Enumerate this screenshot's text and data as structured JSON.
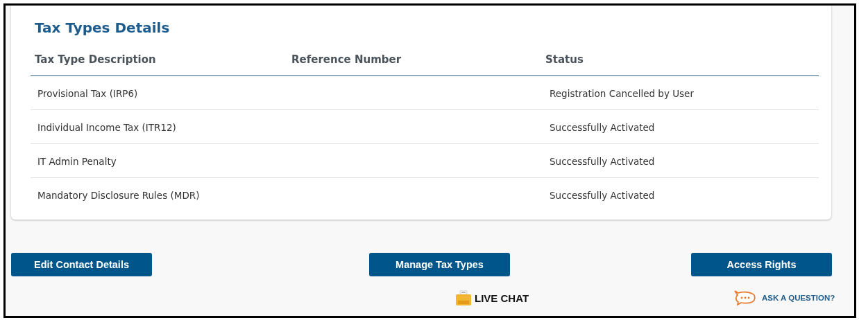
{
  "card": {
    "title": "Tax Types Details",
    "table": {
      "columns": [
        "Tax Type Description",
        "Reference Number",
        "Status"
      ],
      "rows": [
        {
          "description": "Provisional Tax (IRP6)",
          "status": "Registration Cancelled by User"
        },
        {
          "description": "Individual Income Tax (ITR12)",
          "status": "Successfully Activated"
        },
        {
          "description": "IT Admin Penalty",
          "status": "Successfully Activated"
        },
        {
          "description": "Mandatory Disclosure Rules (MDR)",
          "status": "Successfully Activated"
        }
      ]
    }
  },
  "buttons": [
    "Edit Contact Details",
    "Manage Tax Types",
    "Access Rights"
  ],
  "footer": {
    "live_chat": "LIVE CHAT",
    "ask": "ASK A QUESTION?"
  }
}
